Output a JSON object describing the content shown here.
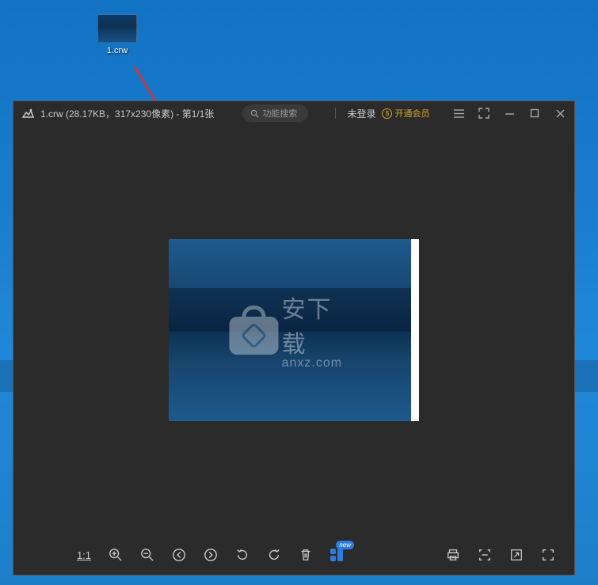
{
  "desktop": {
    "file_label": "1.crw"
  },
  "viewer": {
    "title": "1.crw (28.17KB，317x230像素) - 第1/1张",
    "search_placeholder": "功能搜索",
    "login_text": "未登录",
    "vip_text": "开通会员",
    "watermark": {
      "cn": "安下载",
      "en": "anxz.com"
    }
  },
  "toolbar": {
    "ratio_label": "1:1",
    "new_badge": "new"
  }
}
